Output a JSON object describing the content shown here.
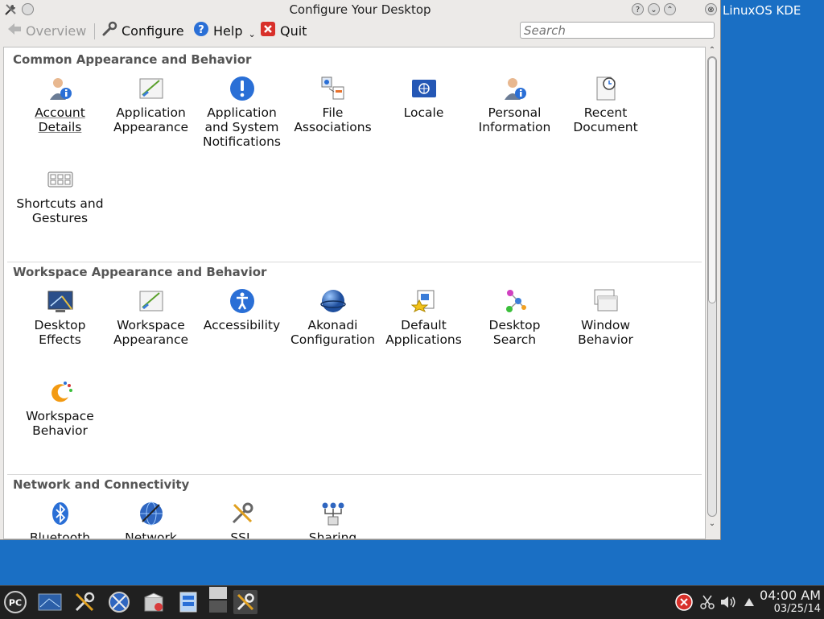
{
  "desktop": {
    "label": "LinuxOS KDE"
  },
  "window": {
    "title": "Configure Your Desktop",
    "buttons": {
      "help": "?",
      "minimize": "⌄",
      "maximize": "⌃",
      "close": "⊗"
    }
  },
  "toolbar": {
    "overview": "Overview",
    "configure": "Configure",
    "help": "Help",
    "help_arrow": "⌄",
    "quit": "Quit",
    "search_placeholder": "Search"
  },
  "sections": [
    {
      "title": "Common Appearance and Behavior",
      "items": [
        {
          "label": "Account Details",
          "icon": "user-info-icon"
        },
        {
          "label": "Application Appearance",
          "icon": "appearance-icon"
        },
        {
          "label": "Application and System Notifications",
          "icon": "notification-icon"
        },
        {
          "label": "File Associations",
          "icon": "file-associations-icon"
        },
        {
          "label": "Locale",
          "icon": "flag-icon"
        },
        {
          "label": "Personal Information",
          "icon": "user-info-icon"
        },
        {
          "label": "Recent Document",
          "icon": "recent-document-icon"
        },
        {
          "label": "Shortcuts and Gestures",
          "icon": "keyboard-icon"
        }
      ]
    },
    {
      "title": "Workspace Appearance and Behavior",
      "items": [
        {
          "label": "Desktop Effects",
          "icon": "desktop-effects-icon"
        },
        {
          "label": "Workspace Appearance",
          "icon": "appearance-icon"
        },
        {
          "label": "Accessibility",
          "icon": "accessibility-icon"
        },
        {
          "label": "Akonadi Configuration",
          "icon": "akonadi-icon"
        },
        {
          "label": "Default Applications",
          "icon": "default-apps-icon"
        },
        {
          "label": "Desktop Search",
          "icon": "desktop-search-icon"
        },
        {
          "label": "Window Behavior",
          "icon": "window-icon"
        },
        {
          "label": "Workspace Behavior",
          "icon": "workspace-behavior-icon"
        }
      ]
    },
    {
      "title": "Network and Connectivity",
      "items": [
        {
          "label": "Bluetooth",
          "icon": "bluetooth-icon"
        },
        {
          "label": "Network",
          "icon": "network-globe-icon"
        },
        {
          "label": "SSL",
          "icon": "tools-icon"
        },
        {
          "label": "Sharing",
          "icon": "sharing-icon"
        }
      ]
    }
  ],
  "taskbar": {
    "time": "04:00 AM",
    "date": "03/25/14",
    "pc_label": "PC"
  },
  "colors": {
    "desktop": "#1a6fc4",
    "taskbar": "#202020",
    "accent": "#2a6fd6"
  }
}
